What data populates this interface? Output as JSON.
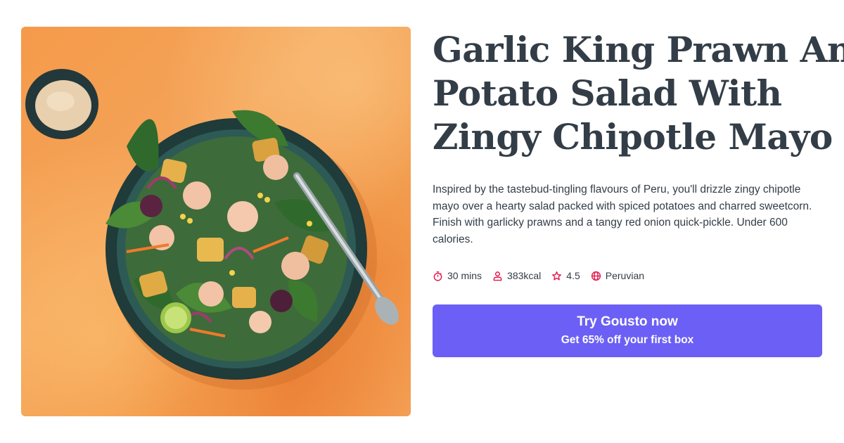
{
  "recipe": {
    "title_lines": [
      "Garlic King Prawn And",
      "Potato Salad With",
      "Zingy Chipotle Mayo"
    ],
    "description": "Inspired by the tastebud-tingling flavours of Peru, you'll drizzle zingy chipotle mayo over a hearty salad packed with spiced potatoes and charred sweetcorn. Finish with garlicky prawns and a tangy red onion quick-pickle. Under 600 calories.",
    "meta": [
      {
        "icon": "timer-icon",
        "label": "30 mins"
      },
      {
        "icon": "person-icon",
        "label": "383kcal"
      },
      {
        "icon": "star-icon",
        "label": "4.5"
      },
      {
        "icon": "globe-icon",
        "label": "Peruvian"
      }
    ]
  },
  "cta": {
    "label": "Try Gousto now",
    "sublabel": "Get 65% off your first box"
  },
  "colors": {
    "accent": "#6c5ff5",
    "icon": "#e5174b",
    "text": "#333d47",
    "background": "#f49a48"
  }
}
